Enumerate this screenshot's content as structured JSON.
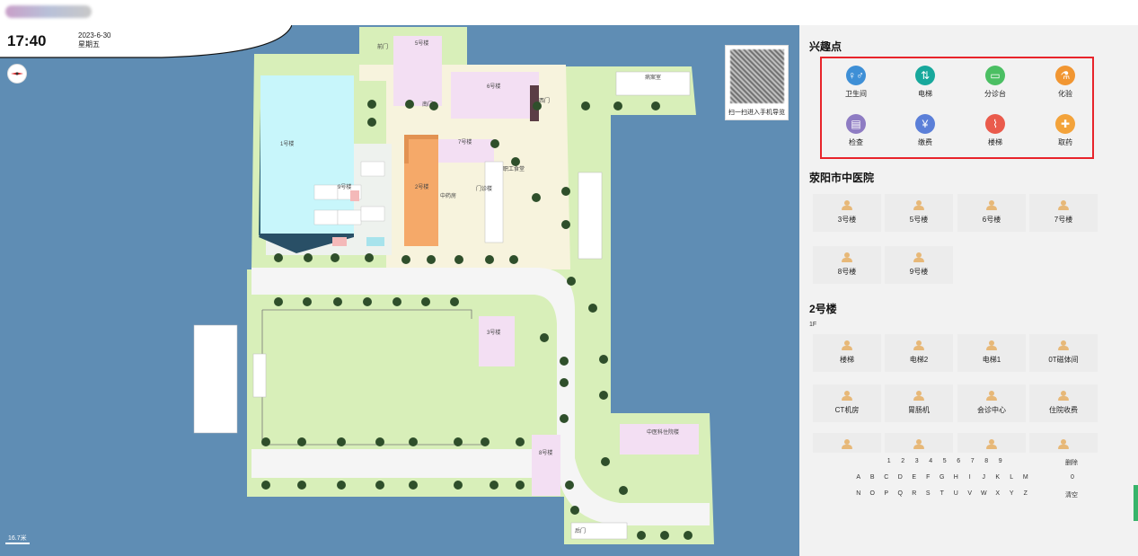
{
  "header": {
    "time": "17:40",
    "date": "2023-6-30",
    "weekday": "星期五"
  },
  "map": {
    "qr_caption": "扫一扫进入手机导览",
    "scale_label": "16.7米",
    "labels": [
      "5号楼",
      "6号楼",
      "1号楼",
      "2号楼",
      "3号楼",
      "7号楼",
      "8号楼",
      "9号楼",
      "职工食堂",
      "病案室",
      "门诊楼",
      "中医科住院楼",
      "前门",
      "南门",
      "西门",
      "后门",
      "中药房"
    ]
  },
  "panel": {
    "poi_title": "兴趣点",
    "poi_items": [
      {
        "label": "卫生间",
        "color": "#3e8fd6",
        "icon": "restroom-icon",
        "glyph": "♀♂"
      },
      {
        "label": "电梯",
        "color": "#18a89c",
        "icon": "elevator-icon",
        "glyph": "⇅"
      },
      {
        "label": "分诊台",
        "color": "#4bbf63",
        "icon": "triage-desk-icon",
        "glyph": "▭"
      },
      {
        "label": "化验",
        "color": "#f19632",
        "icon": "lab-test-icon",
        "glyph": "⚗"
      },
      {
        "label": "检查",
        "color": "#8e7cc3",
        "icon": "examination-icon",
        "glyph": "▤"
      },
      {
        "label": "缴费",
        "color": "#5b7fd8",
        "icon": "payment-icon",
        "glyph": "¥"
      },
      {
        "label": "楼梯",
        "color": "#ea5b4c",
        "icon": "stairs-icon",
        "glyph": "⌇"
      },
      {
        "label": "取药",
        "color": "#f3a33b",
        "icon": "pharmacy-icon",
        "glyph": "✚"
      }
    ],
    "hospital_title": "荥阳市中医院",
    "buildings": [
      "3号楼",
      "5号楼",
      "6号楼",
      "7号楼",
      "8号楼",
      "9号楼"
    ],
    "building_title": "2号楼",
    "floor": "1F",
    "rooms": [
      "楼梯",
      "电梯2",
      "电梯1",
      "0T磁体间",
      "CT机房",
      "胃肠机",
      "会诊中心",
      "住院收费",
      "",
      "",
      "",
      ""
    ],
    "keyboard_rows": [
      [
        "1",
        "2",
        "3",
        "4",
        "5",
        "6",
        "7",
        "8",
        "9"
      ],
      [
        "A",
        "B",
        "C",
        "D",
        "E",
        "F",
        "G",
        "H",
        "I",
        "J",
        "K",
        "L",
        "M"
      ],
      [
        "N",
        "O",
        "P",
        "Q",
        "R",
        "S",
        "T",
        "U",
        "V",
        "W",
        "X",
        "Y",
        "Z"
      ]
    ],
    "key_delete": "删除",
    "key_zero": "0",
    "key_clear": "清空"
  }
}
